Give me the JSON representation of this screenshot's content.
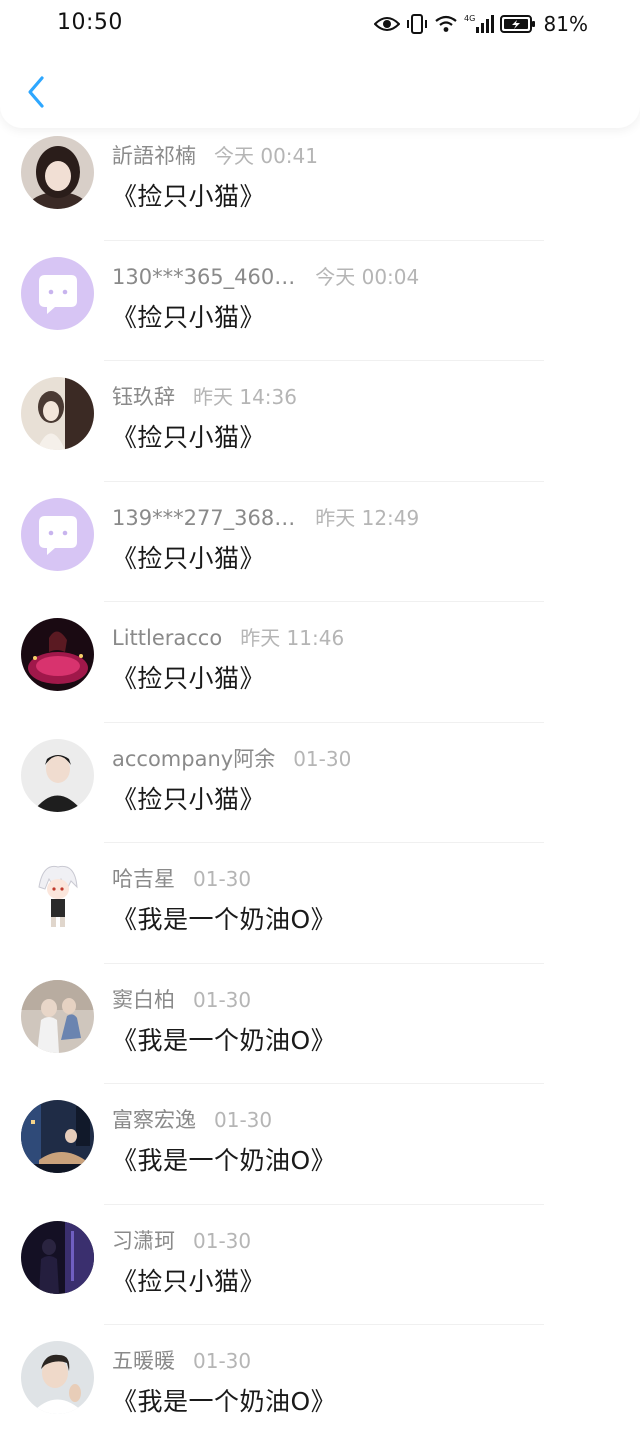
{
  "status_bar": {
    "time": "10:50",
    "battery": "81%"
  },
  "header": {
    "back_icon": "chevron-left-icon",
    "accent_color": "#2ea7ff"
  },
  "messages": [
    {
      "nickname": "訢語祁楠",
      "time": "今天 00:41",
      "text": "《捡只小猫》"
    },
    {
      "nickname": "130***365_460…",
      "time": "今天 00:04",
      "text": "《捡只小猫》"
    },
    {
      "nickname": "钰玖辞",
      "time": "昨天 14:36",
      "text": "《捡只小猫》"
    },
    {
      "nickname": "139***277_368…",
      "time": "昨天 12:49",
      "text": "《捡只小猫》"
    },
    {
      "nickname": "Littleracco",
      "time": "昨天 11:46",
      "text": "《捡只小猫》"
    },
    {
      "nickname": "accompany阿余",
      "time": "01-30",
      "text": "《捡只小猫》"
    },
    {
      "nickname": "哈吉星",
      "time": "01-30",
      "text": "《我是一个奶油O》"
    },
    {
      "nickname": "窦白柏",
      "time": "01-30",
      "text": "《我是一个奶油O》"
    },
    {
      "nickname": "富察宏逸",
      "time": "01-30",
      "text": "《我是一个奶油O》"
    },
    {
      "nickname": "习潇珂",
      "time": "01-30",
      "text": "《捡只小猫》"
    },
    {
      "nickname": "五暖暖",
      "time": "01-30",
      "text": "《我是一个奶油O》"
    }
  ]
}
